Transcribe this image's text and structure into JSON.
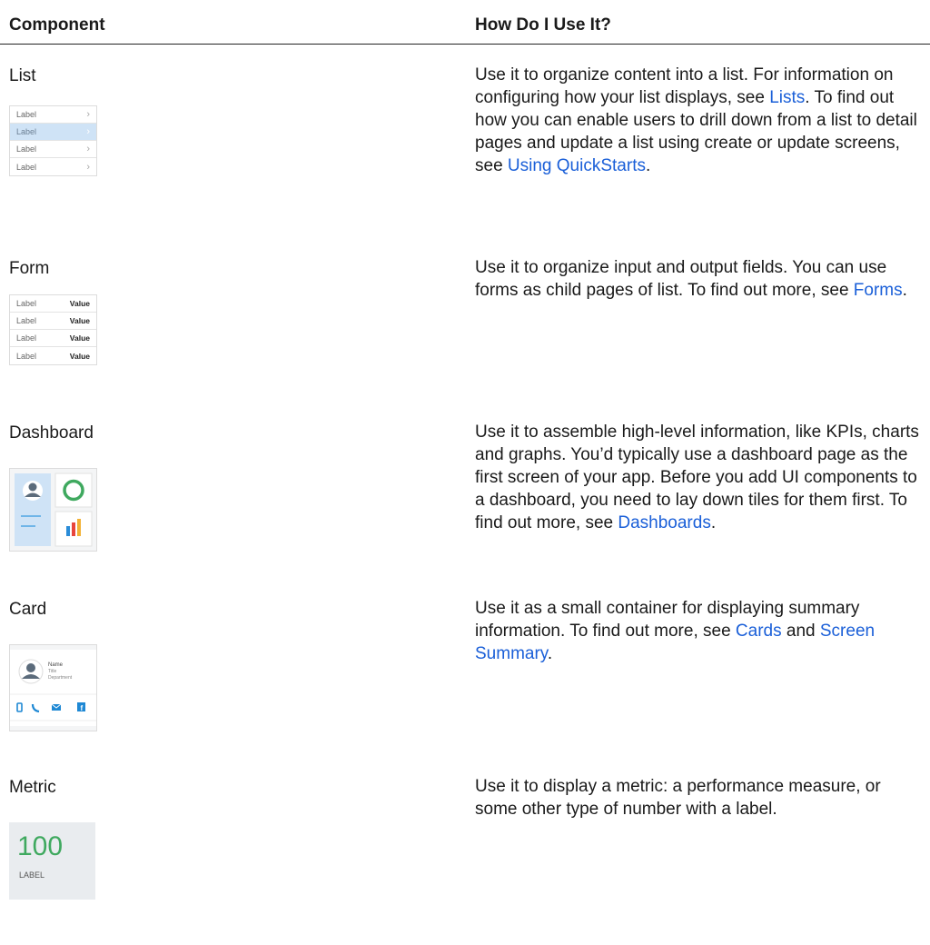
{
  "header": {
    "col1": "Component",
    "col2": "How Do I Use It?"
  },
  "rows": [
    {
      "name": "List",
      "desc": [
        {
          "t": "Use it to organize content into a list. For information on configuring how your list displays, see "
        },
        {
          "t": "Lists",
          "link": true
        },
        {
          "t": ". To find out how you can enable users to drill down from a list to detail pages and update a list using create or update screens, see "
        },
        {
          "t": "Using QuickStarts",
          "link": true
        },
        {
          "t": "."
        }
      ]
    },
    {
      "name": "Form",
      "desc": [
        {
          "t": "Use it to organize input and output fields. You can use forms as child pages of list. To find out more, see "
        },
        {
          "t": "Forms",
          "link": true
        },
        {
          "t": "."
        }
      ]
    },
    {
      "name": "Dashboard",
      "desc": [
        {
          "t": "Use it to assemble high-level information, like KPIs, charts and graphs. You’d typically use a dashboard page as the first screen of your app. Before you add UI components to a dashboard, you need to lay down tiles for them first. To find out more, see "
        },
        {
          "t": "Dashboards",
          "link": true
        },
        {
          "t": "."
        }
      ]
    },
    {
      "name": "Card",
      "desc": [
        {
          "t": "Use it as a small container for displaying summary information. To find out more, see "
        },
        {
          "t": "Cards",
          "link": true
        },
        {
          "t": " and "
        },
        {
          "t": "Screen Summary",
          "link": true
        },
        {
          "t": "."
        }
      ]
    },
    {
      "name": "Metric",
      "desc": [
        {
          "t": "Use it to display a metric: a performance measure, or some other type of number with a label."
        }
      ]
    }
  ],
  "thumbs": {
    "list_items": [
      "Label",
      "Label",
      "Label",
      "Label"
    ],
    "form_items": [
      {
        "label": "Label",
        "value": "Value"
      },
      {
        "label": "Label",
        "value": "Value"
      },
      {
        "label": "Label",
        "value": "Value"
      },
      {
        "label": "Label",
        "value": "Value"
      }
    ],
    "card": {
      "name": "Name",
      "title": "Title",
      "department": "Department"
    },
    "metric": {
      "value": "100",
      "label": "LABEL"
    }
  },
  "colors": {
    "link": "#1a5fd8",
    "metric_value": "#3fa95f",
    "selected_row": "#cfe3f6",
    "accent_blue": "#1e88d4"
  }
}
